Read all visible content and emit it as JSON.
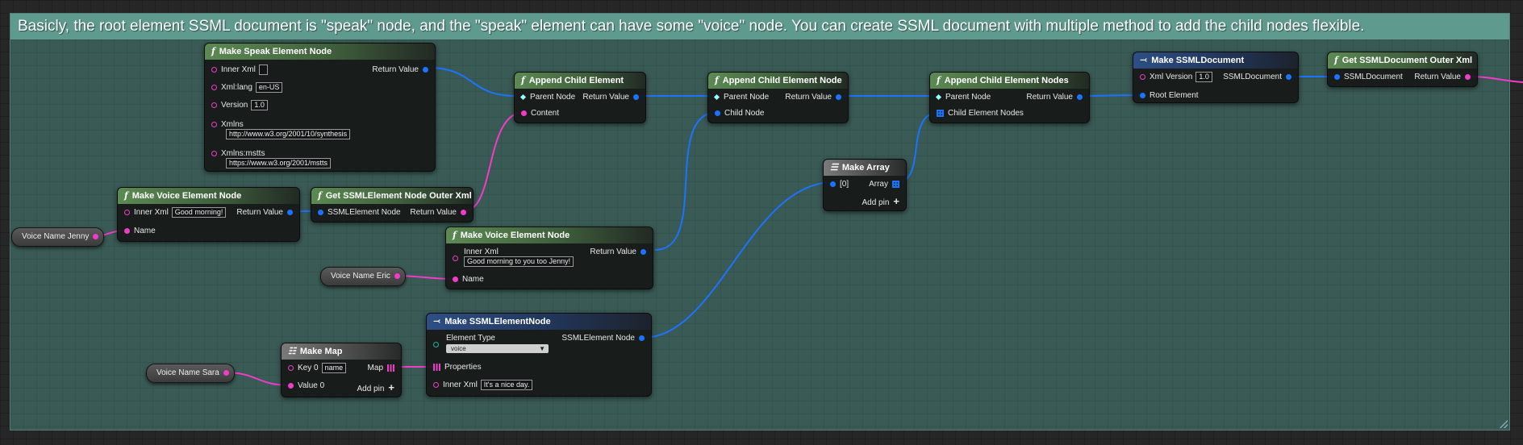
{
  "comment": {
    "title": "Basicly, the root element SSML document is \"speak\" node, and the \"speak\" element can have some \"voice\" node.  You can create SSML document with multiple method to add the child nodes flexible."
  },
  "speak_node": {
    "title": "Make Speak Element Node",
    "inner_xml_label": "Inner Xml",
    "inner_xml_value": "",
    "lang_label": "Xml:lang",
    "lang_value": "en-US",
    "version_label": "Version",
    "version_value": "1.0",
    "xmlns_label": "Xmlns",
    "xmlns_value": "http://www.w3.org/2001/10/synthesis",
    "mstts_label": "Xmlns:mstts",
    "mstts_value": "https://www.w3.org/2001/mstts",
    "return_label": "Return Value"
  },
  "voice_jenny": {
    "title": "Make Voice Element Node",
    "inner_xml_label": "Inner Xml",
    "inner_xml_value": "Good morning!",
    "name_label": "Name",
    "return_label": "Return Value"
  },
  "get_outer": {
    "title": "Get SSMLElement Node Outer Xml",
    "input_label": "SSMLElement Node",
    "return_label": "Return Value"
  },
  "append_child": {
    "title": "Append Child Element",
    "parent_label": "Parent Node",
    "content_label": "Content",
    "return_label": "Return Value"
  },
  "append_child_node": {
    "title": "Append Child Element Node",
    "parent_label": "Parent Node",
    "child_label": "Child Node",
    "return_label": "Return Value"
  },
  "append_child_nodes": {
    "title": "Append Child Element Nodes",
    "parent_label": "Parent Node",
    "children_label": "Child Element Nodes",
    "return_label": "Return Value"
  },
  "make_array": {
    "title": "Make Array",
    "item0_label": "[0]",
    "array_label": "Array",
    "add_pin_label": "Add pin"
  },
  "make_ssml_doc": {
    "title": "Make SSMLDocument",
    "version_label": "Xml Version",
    "version_value": "1.0",
    "root_label": "Root Element",
    "output_label": "SSMLDocument"
  },
  "get_doc_outer": {
    "title": "Get SSMLDocument Outer Xml",
    "input_label": "SSMLDocument",
    "return_label": "Return Value"
  },
  "voice_eric_node": {
    "title": "Make Voice Element Node",
    "inner_xml_label": "Inner Xml",
    "inner_xml_value": "Good morning to you too Jenny!",
    "name_label": "Name",
    "return_label": "Return Value"
  },
  "make_element_node": {
    "title": "Make SSMLElementNode",
    "type_label": "Element Type",
    "type_value": "voice",
    "properties_label": "Properties",
    "inner_xml_label": "Inner Xml",
    "inner_xml_value": "It's a nice day.",
    "output_label": "SSMLElement Node"
  },
  "make_map": {
    "title": "Make Map",
    "key_label": "Key 0",
    "key_value": "name",
    "value_label": "Value 0",
    "map_label": "Map",
    "add_pin_label": "Add pin"
  },
  "variables": {
    "jenny": "Voice Name Jenny",
    "eric": "Voice Name Eric",
    "sara": "Voice Name Sara"
  },
  "colors": {
    "string_pin": "#f03cc8",
    "object_pin": "#1c73ff",
    "comment_bg": "#3a5a55",
    "comment_header": "#5f9a8e",
    "function_header": "#5c8a53",
    "make_header": "#2d4f86"
  }
}
